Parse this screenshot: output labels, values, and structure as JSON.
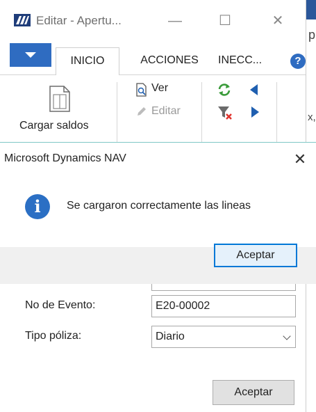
{
  "window": {
    "title": "Editar - Apertu...",
    "minimize_glyph": "—",
    "maximize_glyph": "☐",
    "close_glyph": "✕",
    "edge_chars": [
      "p",
      "x,"
    ]
  },
  "ribbon": {
    "tabs": [
      {
        "label": "INICIO",
        "active": true
      },
      {
        "label": "ACCIONES"
      },
      {
        "label": "INECC..."
      }
    ],
    "help_label": "?",
    "actions": {
      "cargar_saldos": "Cargar saldos",
      "ver": "Ver",
      "editar": "Editar"
    },
    "icons": [
      "app-logo-icon",
      "file-menu-caret-icon",
      "help-icon",
      "document-icon",
      "view-icon",
      "edit-pencil-icon",
      "refresh-icon",
      "clear-filter-icon",
      "arrow-left-icon",
      "arrow-right-icon"
    ]
  },
  "dialog": {
    "title": "Microsoft Dynamics NAV",
    "message": "Se cargaron correctamente las lineas",
    "ok_label": "Aceptar",
    "close_glyph": "✕",
    "info_glyph": "i"
  },
  "form": {
    "fields": [
      {
        "label": "No de Evento:",
        "value": "E20-00002"
      },
      {
        "label": "Tipo póliza:",
        "value": "Diario"
      }
    ],
    "ok_label": "Aceptar"
  },
  "colors": {
    "accent_blue": "#2f6cc1",
    "dialog_border": "#7ec8c6",
    "button_focus": "#0078d7",
    "refresh_green": "#3a9b3a",
    "filter_red": "#e0312b"
  }
}
